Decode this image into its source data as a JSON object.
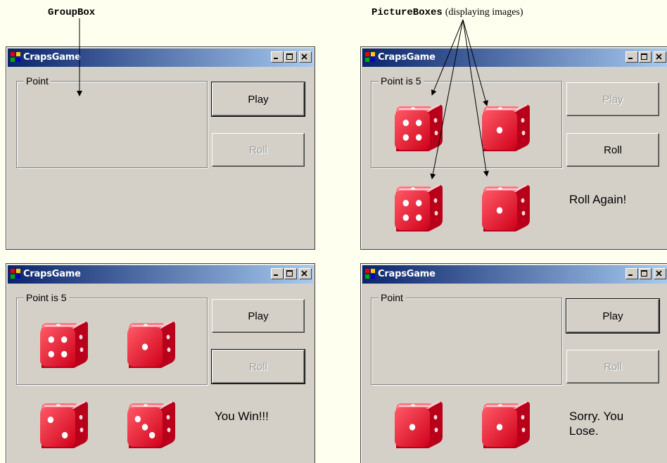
{
  "callouts": {
    "groupbox": "GroupBox",
    "pictureboxes": "PictureBoxes",
    "pictureboxes_note": "(displaying images)"
  },
  "icons": {
    "app": "craps-app-icon",
    "minimize": "minimize-icon",
    "maximize": "maximize-icon",
    "close": "close-icon",
    "die": "red-die-icon"
  },
  "colors": {
    "title_start": "#0a246a",
    "title_end": "#a6caf0",
    "window": "#d4d0c8",
    "die": "#e8102a"
  },
  "windows": [
    {
      "title": "CrapsGame",
      "group_label": "Point",
      "play_label": "Play",
      "roll_label": "Roll",
      "play_enabled": true,
      "roll_enabled": false,
      "status": "",
      "dice": []
    },
    {
      "title": "CrapsGame",
      "group_label": "Point is 5",
      "play_label": "Play",
      "roll_label": "Roll",
      "play_enabled": false,
      "roll_enabled": true,
      "status": "Roll Again!",
      "dice": [
        4,
        1,
        4,
        1
      ]
    },
    {
      "title": "CrapsGame",
      "group_label": "Point is 5",
      "play_label": "Play",
      "roll_label": "Roll",
      "play_enabled": true,
      "roll_enabled": false,
      "status": "You Win!!!",
      "dice": [
        4,
        1,
        2,
        3
      ]
    },
    {
      "title": "CrapsGame",
      "group_label": "Point",
      "play_label": "Play",
      "roll_label": "Roll",
      "play_enabled": true,
      "roll_enabled": false,
      "status_lines": [
        "Sorry. You",
        "Lose."
      ],
      "dice": [
        null,
        null,
        1,
        1
      ]
    }
  ]
}
